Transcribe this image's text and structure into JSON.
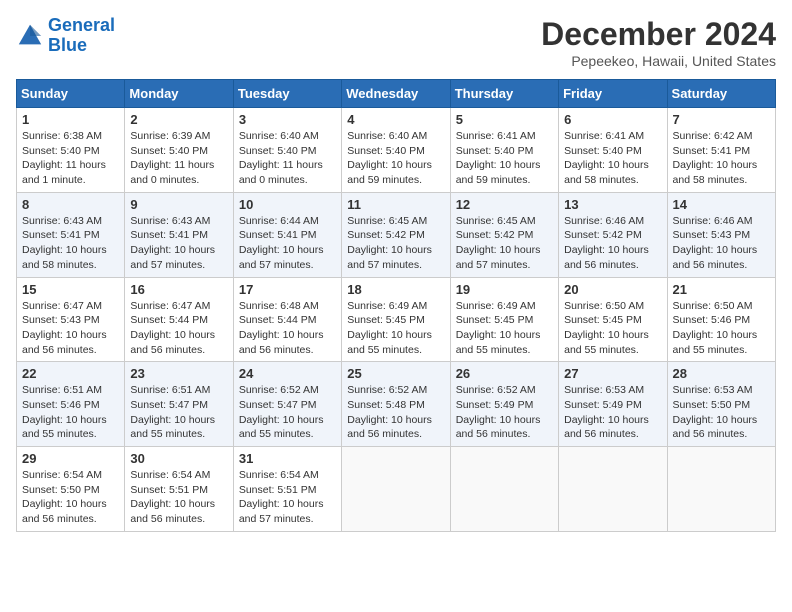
{
  "logo": {
    "line1": "General",
    "line2": "Blue"
  },
  "title": "December 2024",
  "location": "Pepeekeo, Hawaii, United States",
  "days_header": [
    "Sunday",
    "Monday",
    "Tuesday",
    "Wednesday",
    "Thursday",
    "Friday",
    "Saturday"
  ],
  "weeks": [
    [
      {
        "day": "1",
        "info": "Sunrise: 6:38 AM\nSunset: 5:40 PM\nDaylight: 11 hours\nand 1 minute."
      },
      {
        "day": "2",
        "info": "Sunrise: 6:39 AM\nSunset: 5:40 PM\nDaylight: 11 hours\nand 0 minutes."
      },
      {
        "day": "3",
        "info": "Sunrise: 6:40 AM\nSunset: 5:40 PM\nDaylight: 11 hours\nand 0 minutes."
      },
      {
        "day": "4",
        "info": "Sunrise: 6:40 AM\nSunset: 5:40 PM\nDaylight: 10 hours\nand 59 minutes."
      },
      {
        "day": "5",
        "info": "Sunrise: 6:41 AM\nSunset: 5:40 PM\nDaylight: 10 hours\nand 59 minutes."
      },
      {
        "day": "6",
        "info": "Sunrise: 6:41 AM\nSunset: 5:40 PM\nDaylight: 10 hours\nand 58 minutes."
      },
      {
        "day": "7",
        "info": "Sunrise: 6:42 AM\nSunset: 5:41 PM\nDaylight: 10 hours\nand 58 minutes."
      }
    ],
    [
      {
        "day": "8",
        "info": "Sunrise: 6:43 AM\nSunset: 5:41 PM\nDaylight: 10 hours\nand 58 minutes."
      },
      {
        "day": "9",
        "info": "Sunrise: 6:43 AM\nSunset: 5:41 PM\nDaylight: 10 hours\nand 57 minutes."
      },
      {
        "day": "10",
        "info": "Sunrise: 6:44 AM\nSunset: 5:41 PM\nDaylight: 10 hours\nand 57 minutes."
      },
      {
        "day": "11",
        "info": "Sunrise: 6:45 AM\nSunset: 5:42 PM\nDaylight: 10 hours\nand 57 minutes."
      },
      {
        "day": "12",
        "info": "Sunrise: 6:45 AM\nSunset: 5:42 PM\nDaylight: 10 hours\nand 57 minutes."
      },
      {
        "day": "13",
        "info": "Sunrise: 6:46 AM\nSunset: 5:42 PM\nDaylight: 10 hours\nand 56 minutes."
      },
      {
        "day": "14",
        "info": "Sunrise: 6:46 AM\nSunset: 5:43 PM\nDaylight: 10 hours\nand 56 minutes."
      }
    ],
    [
      {
        "day": "15",
        "info": "Sunrise: 6:47 AM\nSunset: 5:43 PM\nDaylight: 10 hours\nand 56 minutes."
      },
      {
        "day": "16",
        "info": "Sunrise: 6:47 AM\nSunset: 5:44 PM\nDaylight: 10 hours\nand 56 minutes."
      },
      {
        "day": "17",
        "info": "Sunrise: 6:48 AM\nSunset: 5:44 PM\nDaylight: 10 hours\nand 56 minutes."
      },
      {
        "day": "18",
        "info": "Sunrise: 6:49 AM\nSunset: 5:45 PM\nDaylight: 10 hours\nand 55 minutes."
      },
      {
        "day": "19",
        "info": "Sunrise: 6:49 AM\nSunset: 5:45 PM\nDaylight: 10 hours\nand 55 minutes."
      },
      {
        "day": "20",
        "info": "Sunrise: 6:50 AM\nSunset: 5:45 PM\nDaylight: 10 hours\nand 55 minutes."
      },
      {
        "day": "21",
        "info": "Sunrise: 6:50 AM\nSunset: 5:46 PM\nDaylight: 10 hours\nand 55 minutes."
      }
    ],
    [
      {
        "day": "22",
        "info": "Sunrise: 6:51 AM\nSunset: 5:46 PM\nDaylight: 10 hours\nand 55 minutes."
      },
      {
        "day": "23",
        "info": "Sunrise: 6:51 AM\nSunset: 5:47 PM\nDaylight: 10 hours\nand 55 minutes."
      },
      {
        "day": "24",
        "info": "Sunrise: 6:52 AM\nSunset: 5:47 PM\nDaylight: 10 hours\nand 55 minutes."
      },
      {
        "day": "25",
        "info": "Sunrise: 6:52 AM\nSunset: 5:48 PM\nDaylight: 10 hours\nand 56 minutes."
      },
      {
        "day": "26",
        "info": "Sunrise: 6:52 AM\nSunset: 5:49 PM\nDaylight: 10 hours\nand 56 minutes."
      },
      {
        "day": "27",
        "info": "Sunrise: 6:53 AM\nSunset: 5:49 PM\nDaylight: 10 hours\nand 56 minutes."
      },
      {
        "day": "28",
        "info": "Sunrise: 6:53 AM\nSunset: 5:50 PM\nDaylight: 10 hours\nand 56 minutes."
      }
    ],
    [
      {
        "day": "29",
        "info": "Sunrise: 6:54 AM\nSunset: 5:50 PM\nDaylight: 10 hours\nand 56 minutes."
      },
      {
        "day": "30",
        "info": "Sunrise: 6:54 AM\nSunset: 5:51 PM\nDaylight: 10 hours\nand 56 minutes."
      },
      {
        "day": "31",
        "info": "Sunrise: 6:54 AM\nSunset: 5:51 PM\nDaylight: 10 hours\nand 57 minutes."
      },
      {
        "day": "",
        "info": ""
      },
      {
        "day": "",
        "info": ""
      },
      {
        "day": "",
        "info": ""
      },
      {
        "day": "",
        "info": ""
      }
    ]
  ]
}
